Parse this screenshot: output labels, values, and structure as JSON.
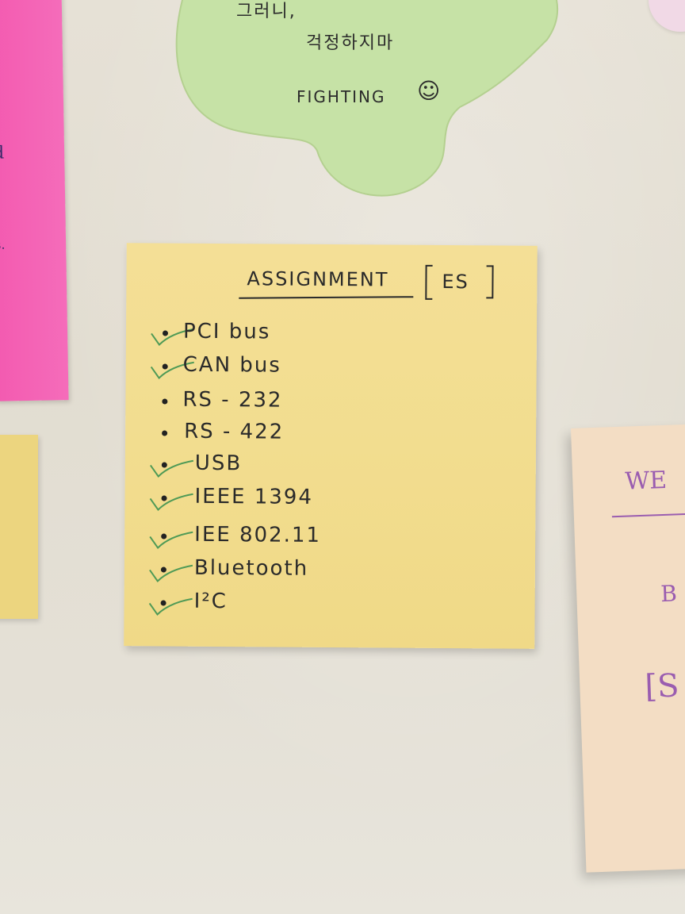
{
  "pink_note": {
    "fragments": [
      "d",
      "s."
    ]
  },
  "green_note": {
    "line1": "그러니,",
    "line2": "걱정하지마",
    "line3": "FIGHTING",
    "smiley": "☺"
  },
  "assignment_note": {
    "title": "ASSIGNMENT",
    "tag": "ES",
    "items": [
      {
        "label": "PCI bus",
        "checked": true
      },
      {
        "label": "CAN bus",
        "checked": true
      },
      {
        "label": "RS - 232",
        "checked": false
      },
      {
        "label": "RS - 422",
        "checked": false
      },
      {
        "label": "USB",
        "checked": true
      },
      {
        "label": "IEEE 1394",
        "checked": true
      },
      {
        "label": "IEE 802.11",
        "checked": true
      },
      {
        "label": "Bluetooth",
        "checked": true
      },
      {
        "label": "I²C",
        "checked": true
      }
    ]
  },
  "peach_note": {
    "fragments": [
      "WE",
      "B",
      "[S"
    ]
  },
  "colors": {
    "check": "#4f9a56",
    "ink": "#2a2a2a",
    "purple_ink": "#9a5db0"
  }
}
